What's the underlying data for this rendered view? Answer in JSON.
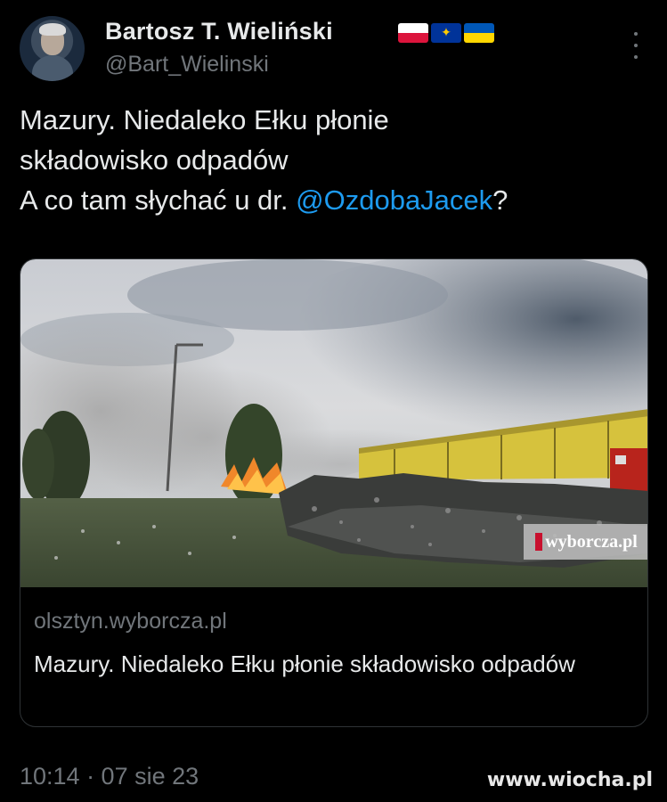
{
  "author": {
    "display_name": "Bartosz T. Wieliński",
    "handle": "@Bart_Wielinski",
    "avatar_icon": "user-avatar",
    "flags": [
      "flag-poland-icon",
      "flag-eu-icon",
      "flag-ukraine-icon"
    ]
  },
  "menu": {
    "icon": "more-vertical-icon"
  },
  "tweet": {
    "line1": "Mazury. Niedaleko Ełku płonie",
    "line2": "składowisko odpadów",
    "line3_prefix": "A co tam słychać u dr. ",
    "mention": "@OzdobaJacek",
    "line3_suffix": "?"
  },
  "card": {
    "image_watermark": "wyborcza.pl",
    "domain": "olsztyn.wyborcza.pl",
    "title": "Mazury. Niedaleko Ełku płonie składowisko odpadów"
  },
  "meta": {
    "timestamp": "10:14 · 07 sie 23"
  },
  "site_watermark": "www.wiocha.pl",
  "colors": {
    "background": "#000000",
    "text": "#e7e9ea",
    "secondary": "#71767b",
    "link": "#1d9bf0",
    "border": "#2f3336"
  }
}
